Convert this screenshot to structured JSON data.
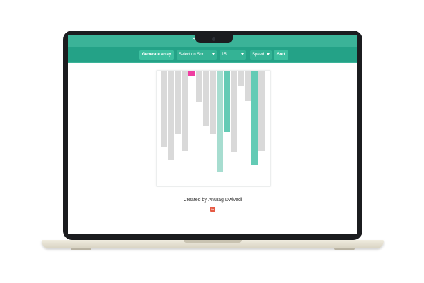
{
  "app": {
    "title": "Sorting Visualizer"
  },
  "toolbar": {
    "generate_label": "Generate array",
    "algorithm_selected": "Selection Sort",
    "size_selected": "15",
    "speed_selected": "Speed",
    "sort_label": "Sort"
  },
  "visualizer": {
    "array_values": [
      74,
      88,
      60,
      78,
      0,
      27,
      52,
      60,
      100,
      59,
      79,
      10,
      26,
      93,
      78
    ],
    "bar_states": [
      "default",
      "default",
      "default",
      "default",
      "compare",
      "default",
      "default",
      "default",
      "light-sorted",
      "sorted",
      "default",
      "default",
      "default",
      "sorted",
      "default"
    ],
    "colors": {
      "default": "#d9d9d9",
      "compare": "#ef3ea1",
      "sorted": "#63cbb5",
      "light-sorted": "#a7ddd0",
      "accent": "#3bb398"
    }
  },
  "footer": {
    "credit": "Created by Anurag Dwivedi",
    "linkedin_label": "in"
  }
}
